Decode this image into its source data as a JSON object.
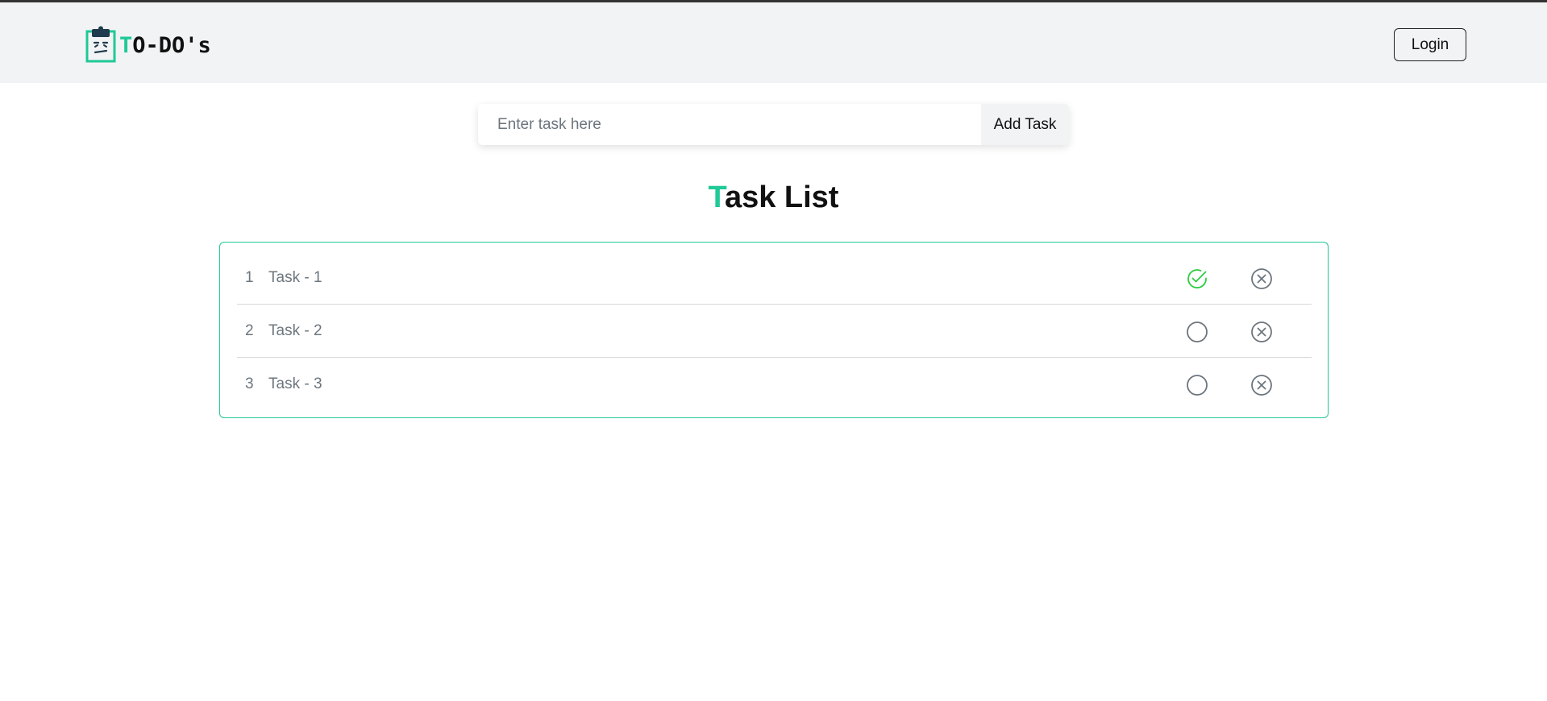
{
  "navbar": {
    "brand_first_letter": "T",
    "brand_rest": "O-DO's",
    "login_label": "Login"
  },
  "form": {
    "input_value": "",
    "input_placeholder": "Enter task here",
    "add_label": "Add Task"
  },
  "list": {
    "title_first_letter": "T",
    "title_rest": "ask List",
    "tasks": [
      {
        "number": "1",
        "name": "Task - 1",
        "completed": true
      },
      {
        "number": "2",
        "name": "Task - 2",
        "completed": false
      },
      {
        "number": "3",
        "name": "Task - 3",
        "completed": false
      }
    ]
  },
  "colors": {
    "accent": "#20c997",
    "check_done": "#2ecc40",
    "icon_gray": "#6c757d",
    "navbar_bg": "#f2f3f5"
  },
  "icons": {
    "logo": "clipboard-icon",
    "complete_done": "check-circle-icon",
    "complete_pending": "circle-icon",
    "delete": "x-circle-icon"
  }
}
